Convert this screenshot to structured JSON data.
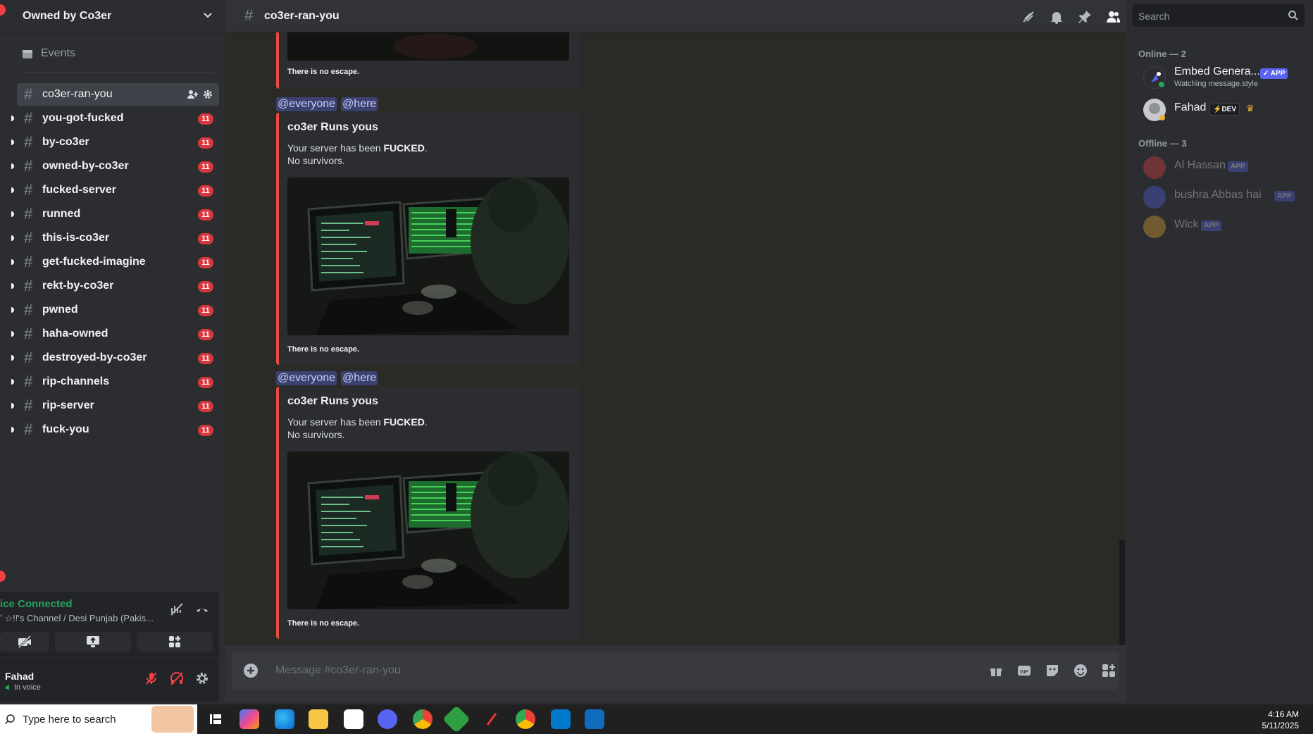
{
  "server": {
    "name": "Owned by Co3er"
  },
  "sidebar": {
    "events_label": "Events",
    "channels": [
      {
        "name": "co3er-ran-you",
        "active": true,
        "badge": ""
      },
      {
        "name": "you-got-fucked",
        "badge": "11"
      },
      {
        "name": "by-co3er",
        "badge": "11"
      },
      {
        "name": "owned-by-co3er",
        "badge": "11"
      },
      {
        "name": "fucked-server",
        "badge": "11"
      },
      {
        "name": "runned",
        "badge": "11"
      },
      {
        "name": "this-is-co3er",
        "badge": "11"
      },
      {
        "name": "get-fucked-imagine",
        "badge": "11"
      },
      {
        "name": "rekt-by-co3er",
        "badge": "11"
      },
      {
        "name": "pwned",
        "badge": "11"
      },
      {
        "name": "haha-owned",
        "badge": "11"
      },
      {
        "name": "destroyed-by-co3er",
        "badge": "11"
      },
      {
        "name": "rip-channels",
        "badge": "11"
      },
      {
        "name": "rip-server",
        "badge": "11"
      },
      {
        "name": "fuck-you",
        "badge": "11"
      }
    ]
  },
  "voice": {
    "status": "ice Connected",
    "channel": "ʼ ☆!!'s Channel / Desi Punjab (Pakis..."
  },
  "user": {
    "name": "Fahad",
    "status": "In voice"
  },
  "channel_header": {
    "title": "co3er-ran-you",
    "search_placeholder": "Search"
  },
  "messages": {
    "top_footer": "There is no escape.",
    "mention_everyone": "@everyone",
    "mention_here": "@here",
    "embeds": [
      {
        "title": "co3er Runs yous",
        "line1_prefix": "Your server has been ",
        "line1_bold": "FUCKED",
        "line1_suffix": ".",
        "line2": "No survivors.",
        "footer": "There is no escape."
      },
      {
        "title": "co3er Runs yous",
        "line1_prefix": "Your server has been ",
        "line1_bold": "FUCKED",
        "line1_suffix": ".",
        "line2": "No survivors.",
        "footer": "There is no escape."
      }
    ]
  },
  "composer": {
    "placeholder": "Message #co3er-ran-you"
  },
  "members": {
    "online_header": "Online — 2",
    "offline_header": "Offline — 3",
    "online": [
      {
        "name": "Embed Genera...",
        "tag": "APP",
        "sub": "Watching message.style",
        "color": "#5865f2"
      },
      {
        "name": "Fahad",
        "tag": "DEV",
        "sub": "",
        "color": "#b5bac1"
      }
    ],
    "offline": [
      {
        "name": "Al Hassan",
        "tag": "APP",
        "color": "#f23f43"
      },
      {
        "name": "bushra Abbas hai",
        "tag": "APP",
        "color": "#5865f2"
      },
      {
        "name": "Wick",
        "tag": "APP",
        "color": "#f0b232"
      }
    ]
  },
  "taskbar": {
    "search_placeholder": "Type here to search",
    "time": "4:16 AM",
    "date": "5/11/2025"
  },
  "colors": {
    "embed_border": "#e74c3c",
    "badge": "#da373c",
    "connected": "#23a55a",
    "mention_bg": "#3c4270"
  }
}
